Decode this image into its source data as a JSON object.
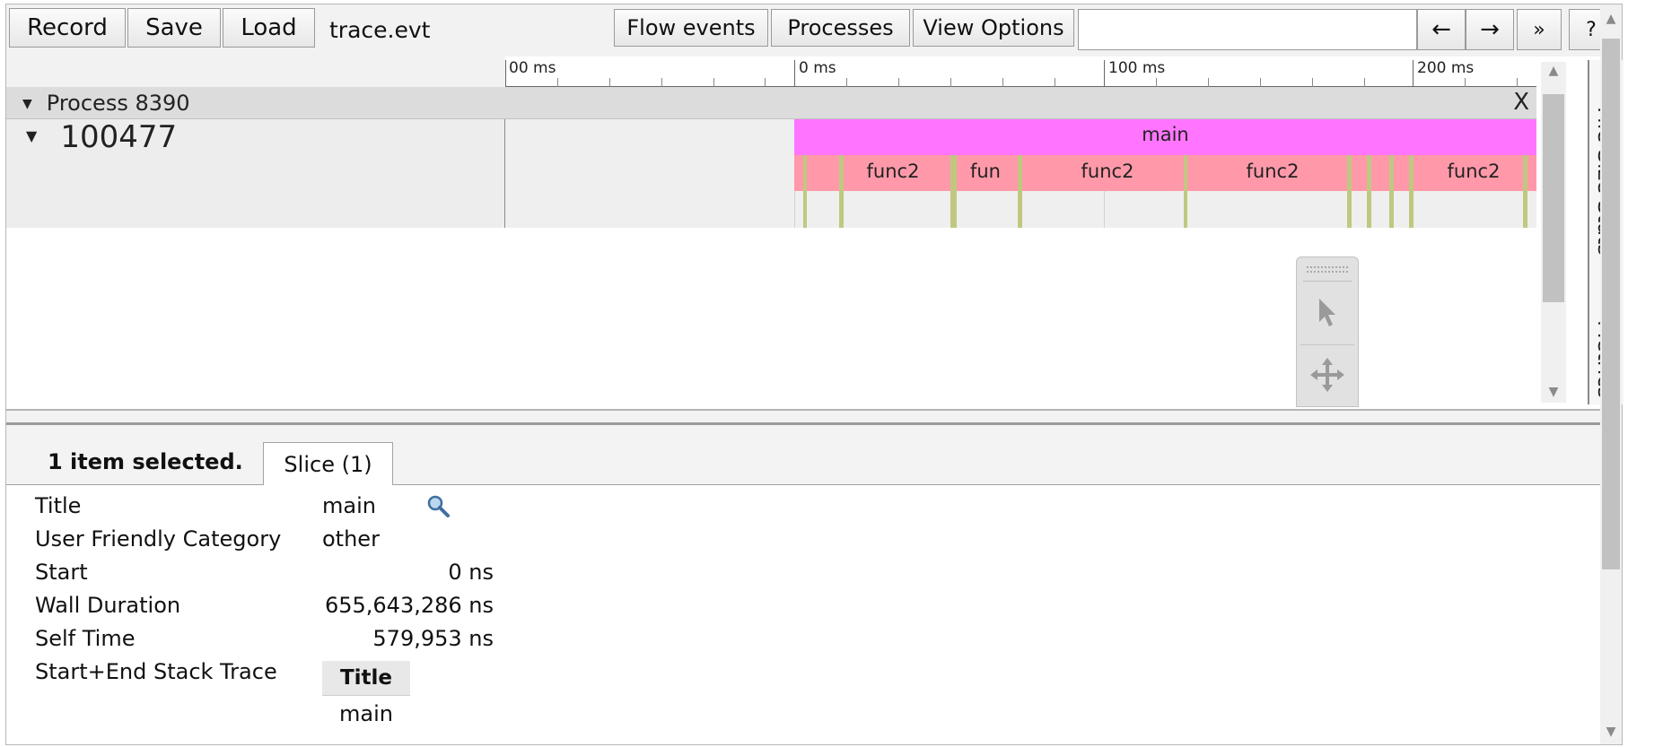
{
  "toolbar": {
    "record": "Record",
    "save": "Save",
    "load": "Load",
    "filename": "trace.evt",
    "flow_events": "Flow events",
    "processes": "Processes",
    "view_options": "View Options",
    "search_placeholder": "",
    "prev": "←",
    "next": "→",
    "more": "»",
    "help": "?"
  },
  "ruler": {
    "labels": [
      "00 ms",
      "0 ms",
      "100 ms",
      "200 ms"
    ]
  },
  "process": {
    "title": "Process 8390",
    "collapse_glyph": "▼",
    "close": "X"
  },
  "thread": {
    "collapse_glyph": "▼",
    "title": "100477",
    "slices": {
      "main": "main",
      "func2_a": "func2",
      "fun": "fun",
      "func2_b": "func2",
      "func2_c": "func2",
      "func2_d": "func2"
    },
    "colors": {
      "main": "#ff75ff",
      "func": "#ff99aa",
      "sample": "#c0c880"
    }
  },
  "side_tabs": {
    "file_size_stats": "File Size Stats",
    "metrics": "Metrics"
  },
  "palette": {
    "tools": [
      "selection-tool",
      "pan-tool"
    ]
  },
  "details": {
    "selection_text": "1 item selected.",
    "tab_label": "Slice (1)",
    "properties": {
      "title_label": "Title",
      "title_value": "main",
      "category_label": "User Friendly Category",
      "category_value": "other",
      "start_label": "Start",
      "start_value": "0 ns",
      "wall_label": "Wall Duration",
      "wall_value": "655,643,286 ns",
      "self_label": "Self Time",
      "self_value": "579,953 ns",
      "stack_label": "Start+End Stack Trace"
    },
    "stack_table": {
      "header": "Title",
      "rows": [
        "main"
      ]
    }
  }
}
